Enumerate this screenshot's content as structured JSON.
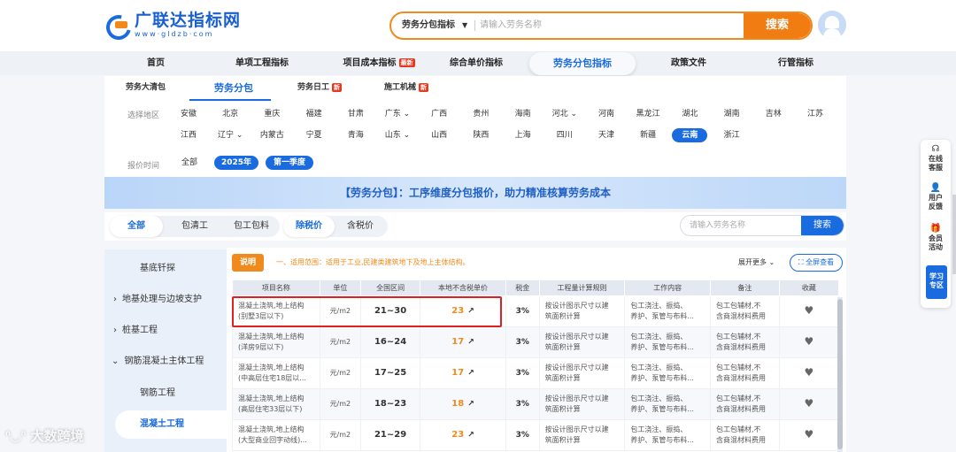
{
  "logo": {
    "title": "广联达指标网",
    "subtitle": "www·gldzb·com"
  },
  "search": {
    "category": "劳务分包指标",
    "placeholder": "请输入劳务名称",
    "button": "搜索"
  },
  "main_nav": [
    {
      "label": "首页"
    },
    {
      "label": "单项工程指标"
    },
    {
      "label": "项目成本指标",
      "badge": "最新"
    },
    {
      "label": "综合单价指标"
    },
    {
      "label": "劳务分包指标"
    },
    {
      "label": "政策文件"
    },
    {
      "label": "行管指标"
    }
  ],
  "sub_nav": [
    {
      "label": "劳务大清包"
    },
    {
      "label": "劳务分包"
    },
    {
      "label": "劳务日工",
      "badge": "新"
    },
    {
      "label": "施工机械",
      "badge": "新"
    }
  ],
  "filters": {
    "region_label": "选择地区",
    "regions_row1": [
      "安徽",
      "北京",
      "重庆",
      "福建",
      "甘肃",
      "广东 ⌄",
      "广西",
      "贵州",
      "海南",
      "河北 ⌄",
      "河南",
      "黑龙江",
      "湖北",
      "湖南",
      "吉林",
      "江苏"
    ],
    "regions_row2": [
      "江西",
      "辽宁 ⌄",
      "内蒙古",
      "宁夏",
      "青海",
      "山东 ⌄",
      "山西",
      "陕西",
      "上海",
      "四川",
      "天津",
      "新疆",
      "云南",
      "浙江"
    ],
    "selected_region": "云南",
    "time_label": "报价时间",
    "time_all": "全部",
    "year": "2025年",
    "quarter": "第一季度"
  },
  "banner": "【劳务分包】：工序维度分包报价，助力精准核算劳务成本",
  "tabs": {
    "group1": [
      "全部",
      "包清工",
      "包工包料"
    ],
    "group2": [
      "除税价",
      "含税价"
    ],
    "search_placeholder": "请输入劳务名称",
    "search_button": "搜索"
  },
  "sidebar": {
    "items": [
      "基底钎探",
      "地基处理与边坡支护",
      "桩基工程",
      "钢筋混凝土主体工程",
      "钢筋工程",
      "混凝土工程"
    ],
    "arrows": [
      "",
      "›",
      "›",
      "⌄",
      "",
      ""
    ]
  },
  "content": {
    "note_badge": "说明",
    "note_text": "一、适用范围：适用于工业,民建类建筑地下及地上主体结构。",
    "expand": "展开更多 ⌄",
    "fullscreen": "全屏查看",
    "columns": [
      "项目名称",
      "单位",
      "全国区间",
      "本地不含税单价",
      "税金",
      "工程量计算规则",
      "工作内容",
      "备注",
      "收藏"
    ],
    "rows": [
      {
        "name1": "混凝土浇筑,地上结构",
        "name2": "(别墅3层以下)",
        "unit": "元/m2",
        "range": "21~30",
        "price": "23",
        "tax": "3%",
        "rule1": "按设计图示尺寸以建",
        "rule2": "筑面积计算",
        "work1": "包工浇注、振捣、",
        "work2": "养护、泵管与布料...",
        "note1": "包工包辅材,不",
        "note2": "含商混材料费用"
      },
      {
        "name1": "混凝土浇筑,地上结构",
        "name2": "(洋房9层以下)",
        "unit": "元/m2",
        "range": "16~24",
        "price": "17",
        "tax": "3%",
        "rule1": "按设计图示尺寸以建",
        "rule2": "筑面积计算",
        "work1": "包工浇注、振捣、",
        "work2": "养护、泵管与布料...",
        "note1": "包工包辅材,不",
        "note2": "含商混材料费用"
      },
      {
        "name1": "混凝土浇筑,地上结构",
        "name2": "(中高层住宅18层以...",
        "unit": "元/m2",
        "range": "17~25",
        "price": "17",
        "tax": "3%",
        "rule1": "按设计图示尺寸以建",
        "rule2": "筑面积计算",
        "work1": "包工浇注、振捣、",
        "work2": "养护、泵管与布料...",
        "note1": "包工包辅材,不",
        "note2": "含商混材料费用"
      },
      {
        "name1": "混凝土浇筑,地上结构",
        "name2": "(高层住宅33层以下)",
        "unit": "元/m2",
        "range": "18~23",
        "price": "18",
        "tax": "3%",
        "rule1": "按设计图示尺寸以建",
        "rule2": "筑面积计算",
        "work1": "包工浇注、振捣、",
        "work2": "养护、泵管与布料...",
        "note1": "包工包辅材,不",
        "note2": "含商混材料费用"
      },
      {
        "name1": "混凝土浇筑,地上结构",
        "name2": "(大型商业回字动线)...",
        "unit": "元/m2",
        "range": "21~29",
        "price": "23",
        "tax": "3%",
        "rule1": "按设计图示尺寸以建",
        "rule2": "筑面积计算",
        "work1": "包工浇注、振捣、",
        "work2": "养护、泵管与布料...",
        "note1": "包工包辅材,不",
        "note2": "含商混材料费用"
      }
    ]
  },
  "side_widget": [
    {
      "icon": "☊",
      "label1": "在线",
      "label2": "客服"
    },
    {
      "icon": "👤",
      "label1": "用户",
      "label2": "反馈"
    },
    {
      "icon": "🎁",
      "label1": "会员",
      "label2": "活动"
    }
  ],
  "study": {
    "label1": "学习",
    "label2": "专区"
  },
  "watermark": "大数跨境",
  "colors": {
    "primary": "#1a6be0",
    "accent": "#f08a1c",
    "highlight": "#e02020"
  }
}
